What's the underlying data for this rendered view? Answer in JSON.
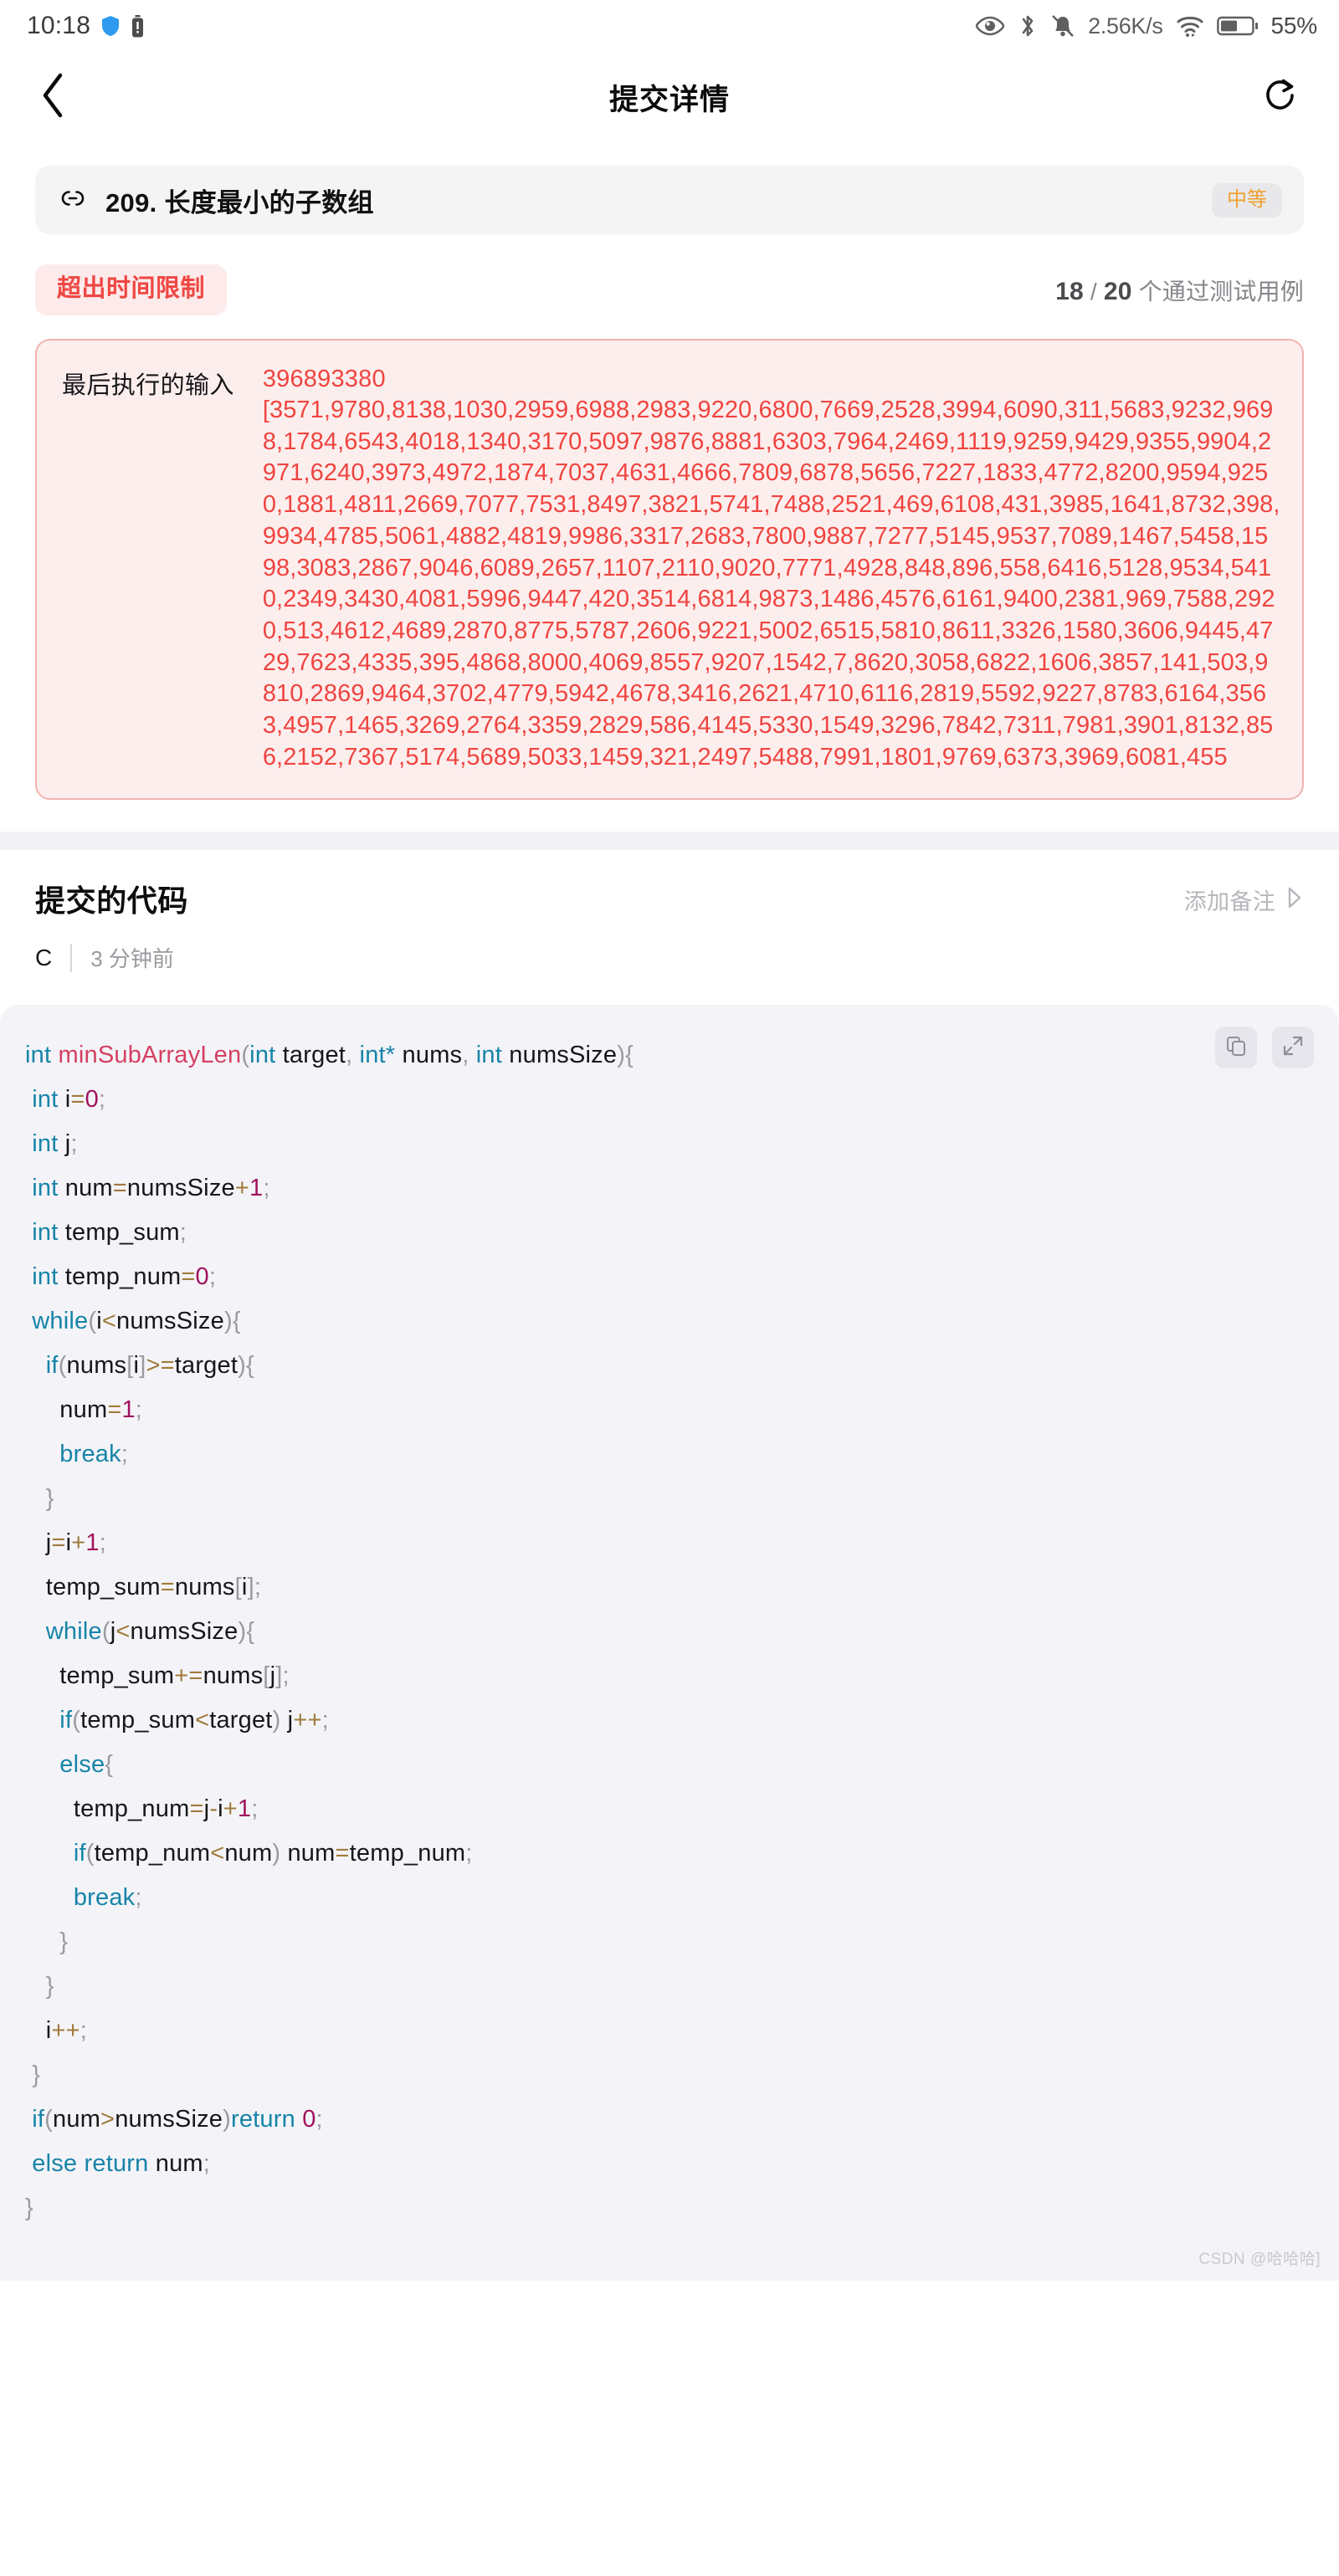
{
  "status_bar": {
    "time": "10:18",
    "network_speed": "2.56K/s",
    "battery_percent": "55%",
    "icons": [
      "shield-icon",
      "battery-small-icon",
      "eye-icon",
      "bluetooth-icon",
      "bell-off-icon",
      "wifi-icon",
      "battery-icon"
    ]
  },
  "header": {
    "title": "提交详情",
    "back_icon": "chevron-left-icon",
    "refresh_icon": "refresh-icon"
  },
  "problem": {
    "link_icon": "link-icon",
    "title": "209. 长度最小的子数组",
    "difficulty": "中等",
    "difficulty_color": "#f0a030"
  },
  "verdict": {
    "status": "超出时间限制",
    "status_color": "#ef4743",
    "status_bg": "#fdeaea",
    "passed": "18",
    "separator": "/",
    "total": "20",
    "cases_suffix": "个通过测试用例"
  },
  "last_input": {
    "label": "最后执行的输入",
    "target": "396893380",
    "array": "[3571,9780,8138,1030,2959,6988,2983,9220,6800,7669,2528,3994,6090,311,5683,9232,9698,1784,6543,4018,1340,3170,5097,9876,8881,6303,7964,2469,1119,9259,9429,9355,9904,2971,6240,3973,4972,1874,7037,4631,4666,7809,6878,5656,7227,1833,4772,8200,9594,9250,1881,4811,2669,7077,7531,8497,3821,5741,7488,2521,469,6108,431,3985,1641,8732,398,9934,4785,5061,4882,4819,9986,3317,2683,7800,9887,7277,5145,9537,7089,1467,5458,1598,3083,2867,9046,6089,2657,1107,2110,9020,7771,4928,848,896,558,6416,5128,9534,5410,2349,3430,4081,5996,9447,420,3514,6814,9873,1486,4576,6161,9400,2381,969,7588,2920,513,4612,4689,2870,8775,5787,2606,9221,5002,6515,5810,8611,3326,1580,3606,9445,4729,7623,4335,395,4868,8000,4069,8557,9207,1542,7,8620,3058,6822,1606,3857,141,503,9810,2869,9464,3702,4779,5942,4678,3416,2621,4710,6116,2819,5592,9227,8783,6164,3563,4957,1465,3269,2764,3359,2829,586,4145,5330,1549,3296,7842,7311,7981,3901,8132,856,2152,7367,5174,5689,5033,1459,321,2497,5488,7991,1801,9769,6373,3969,6081,455",
    "border_color": "#f1b3b1",
    "bg_color": "#fdeeee",
    "text_color": "#f0443f"
  },
  "code_section": {
    "title": "提交的代码",
    "add_note_label": "添加备注",
    "add_note_icon": "chevron-right-icon",
    "language": "C",
    "time_ago": "3 分钟前",
    "copy_icon": "copy-icon",
    "expand_icon": "expand-icon",
    "lines": [
      [
        {
          "t": "int ",
          "c": "tk-key"
        },
        {
          "t": "minSubArrayLen",
          "c": "tk-fn"
        },
        {
          "t": "(",
          "c": "tk-pun"
        },
        {
          "t": "int ",
          "c": "tk-key"
        },
        {
          "t": "target",
          "c": "tk-txt"
        },
        {
          "t": ",",
          "c": "tk-pun"
        },
        {
          "t": " int*",
          "c": "tk-key"
        },
        {
          "t": " nums",
          "c": "tk-txt"
        },
        {
          "t": ",",
          "c": "tk-pun"
        },
        {
          "t": " int ",
          "c": "tk-key"
        },
        {
          "t": "numsSize",
          "c": "tk-txt"
        },
        {
          "t": ")",
          "c": "tk-pun"
        },
        {
          "t": "{",
          "c": "tk-pun"
        }
      ],
      [
        {
          "t": " ",
          "c": "tk-txt"
        },
        {
          "t": "int ",
          "c": "tk-key"
        },
        {
          "t": "i",
          "c": "tk-txt"
        },
        {
          "t": "=",
          "c": "tk-op"
        },
        {
          "t": "0",
          "c": "tk-num"
        },
        {
          "t": ";",
          "c": "tk-pun"
        }
      ],
      [
        {
          "t": " ",
          "c": "tk-txt"
        },
        {
          "t": "int ",
          "c": "tk-key"
        },
        {
          "t": "j",
          "c": "tk-txt"
        },
        {
          "t": ";",
          "c": "tk-pun"
        }
      ],
      [
        {
          "t": " ",
          "c": "tk-txt"
        },
        {
          "t": "int ",
          "c": "tk-key"
        },
        {
          "t": "num",
          "c": "tk-txt"
        },
        {
          "t": "=",
          "c": "tk-op"
        },
        {
          "t": "numsSize",
          "c": "tk-txt"
        },
        {
          "t": "+",
          "c": "tk-op"
        },
        {
          "t": "1",
          "c": "tk-num"
        },
        {
          "t": ";",
          "c": "tk-pun"
        }
      ],
      [
        {
          "t": " ",
          "c": "tk-txt"
        },
        {
          "t": "int ",
          "c": "tk-key"
        },
        {
          "t": "temp_sum",
          "c": "tk-txt"
        },
        {
          "t": ";",
          "c": "tk-pun"
        }
      ],
      [
        {
          "t": " ",
          "c": "tk-txt"
        },
        {
          "t": "int ",
          "c": "tk-key"
        },
        {
          "t": "temp_num",
          "c": "tk-txt"
        },
        {
          "t": "=",
          "c": "tk-op"
        },
        {
          "t": "0",
          "c": "tk-num"
        },
        {
          "t": ";",
          "c": "tk-pun"
        }
      ],
      [
        {
          "t": " ",
          "c": "tk-txt"
        },
        {
          "t": "while",
          "c": "tk-key"
        },
        {
          "t": "(",
          "c": "tk-pun"
        },
        {
          "t": "i",
          "c": "tk-txt"
        },
        {
          "t": "<",
          "c": "tk-op"
        },
        {
          "t": "numsSize",
          "c": "tk-txt"
        },
        {
          "t": ")",
          "c": "tk-pun"
        },
        {
          "t": "{",
          "c": "tk-pun"
        }
      ],
      [
        {
          "t": "   ",
          "c": "tk-txt"
        },
        {
          "t": "if",
          "c": "tk-key"
        },
        {
          "t": "(",
          "c": "tk-pun"
        },
        {
          "t": "nums",
          "c": "tk-txt"
        },
        {
          "t": "[",
          "c": "tk-pun"
        },
        {
          "t": "i",
          "c": "tk-txt"
        },
        {
          "t": "]",
          "c": "tk-pun"
        },
        {
          "t": ">",
          "c": "tk-op"
        },
        {
          "t": "=",
          "c": "tk-op"
        },
        {
          "t": "target",
          "c": "tk-txt"
        },
        {
          "t": ")",
          "c": "tk-pun"
        },
        {
          "t": "{",
          "c": "tk-pun"
        }
      ],
      [
        {
          "t": "     ",
          "c": "tk-txt"
        },
        {
          "t": "num",
          "c": "tk-txt"
        },
        {
          "t": "=",
          "c": "tk-op"
        },
        {
          "t": "1",
          "c": "tk-num"
        },
        {
          "t": ";",
          "c": "tk-pun"
        }
      ],
      [
        {
          "t": "     ",
          "c": "tk-txt"
        },
        {
          "t": "break",
          "c": "tk-key"
        },
        {
          "t": ";",
          "c": "tk-pun"
        }
      ],
      [
        {
          "t": "   ",
          "c": "tk-txt"
        },
        {
          "t": "}",
          "c": "tk-pun"
        }
      ],
      [
        {
          "t": "   ",
          "c": "tk-txt"
        },
        {
          "t": "j",
          "c": "tk-txt"
        },
        {
          "t": "=",
          "c": "tk-op"
        },
        {
          "t": "i",
          "c": "tk-txt"
        },
        {
          "t": "+",
          "c": "tk-op"
        },
        {
          "t": "1",
          "c": "tk-num"
        },
        {
          "t": ";",
          "c": "tk-pun"
        }
      ],
      [
        {
          "t": "   ",
          "c": "tk-txt"
        },
        {
          "t": "temp_sum",
          "c": "tk-txt"
        },
        {
          "t": "=",
          "c": "tk-op"
        },
        {
          "t": "nums",
          "c": "tk-txt"
        },
        {
          "t": "[",
          "c": "tk-pun"
        },
        {
          "t": "i",
          "c": "tk-txt"
        },
        {
          "t": "]",
          "c": "tk-pun"
        },
        {
          "t": ";",
          "c": "tk-pun"
        }
      ],
      [
        {
          "t": "   ",
          "c": "tk-txt"
        },
        {
          "t": "while",
          "c": "tk-key"
        },
        {
          "t": "(",
          "c": "tk-pun"
        },
        {
          "t": "j",
          "c": "tk-txt"
        },
        {
          "t": "<",
          "c": "tk-op"
        },
        {
          "t": "numsSize",
          "c": "tk-txt"
        },
        {
          "t": ")",
          "c": "tk-pun"
        },
        {
          "t": "{",
          "c": "tk-pun"
        }
      ],
      [
        {
          "t": "     ",
          "c": "tk-txt"
        },
        {
          "t": "temp_sum",
          "c": "tk-txt"
        },
        {
          "t": "+=",
          "c": "tk-op"
        },
        {
          "t": "nums",
          "c": "tk-txt"
        },
        {
          "t": "[",
          "c": "tk-pun"
        },
        {
          "t": "j",
          "c": "tk-txt"
        },
        {
          "t": "]",
          "c": "tk-pun"
        },
        {
          "t": ";",
          "c": "tk-pun"
        }
      ],
      [
        {
          "t": "     ",
          "c": "tk-txt"
        },
        {
          "t": "if",
          "c": "tk-key"
        },
        {
          "t": "(",
          "c": "tk-pun"
        },
        {
          "t": "temp_sum",
          "c": "tk-txt"
        },
        {
          "t": "<",
          "c": "tk-op"
        },
        {
          "t": "target",
          "c": "tk-txt"
        },
        {
          "t": ")",
          "c": "tk-pun"
        },
        {
          "t": " j",
          "c": "tk-txt"
        },
        {
          "t": "++",
          "c": "tk-op"
        },
        {
          "t": ";",
          "c": "tk-pun"
        }
      ],
      [
        {
          "t": "     ",
          "c": "tk-txt"
        },
        {
          "t": "else",
          "c": "tk-key"
        },
        {
          "t": "{",
          "c": "tk-pun"
        }
      ],
      [
        {
          "t": "       ",
          "c": "tk-txt"
        },
        {
          "t": "temp_num",
          "c": "tk-txt"
        },
        {
          "t": "=",
          "c": "tk-op"
        },
        {
          "t": "j",
          "c": "tk-txt"
        },
        {
          "t": "-",
          "c": "tk-op"
        },
        {
          "t": "i",
          "c": "tk-txt"
        },
        {
          "t": "+",
          "c": "tk-op"
        },
        {
          "t": "1",
          "c": "tk-num"
        },
        {
          "t": ";",
          "c": "tk-pun"
        }
      ],
      [
        {
          "t": "       ",
          "c": "tk-txt"
        },
        {
          "t": "if",
          "c": "tk-key"
        },
        {
          "t": "(",
          "c": "tk-pun"
        },
        {
          "t": "temp_num",
          "c": "tk-txt"
        },
        {
          "t": "<",
          "c": "tk-op"
        },
        {
          "t": "num",
          "c": "tk-txt"
        },
        {
          "t": ")",
          "c": "tk-pun"
        },
        {
          "t": " num",
          "c": "tk-txt"
        },
        {
          "t": "=",
          "c": "tk-op"
        },
        {
          "t": "temp_num",
          "c": "tk-txt"
        },
        {
          "t": ";",
          "c": "tk-pun"
        }
      ],
      [
        {
          "t": "       ",
          "c": "tk-txt"
        },
        {
          "t": "break",
          "c": "tk-key"
        },
        {
          "t": ";",
          "c": "tk-pun"
        }
      ],
      [
        {
          "t": "     ",
          "c": "tk-txt"
        },
        {
          "t": "}",
          "c": "tk-pun"
        }
      ],
      [
        {
          "t": "   ",
          "c": "tk-txt"
        },
        {
          "t": "}",
          "c": "tk-pun"
        }
      ],
      [
        {
          "t": "   ",
          "c": "tk-txt"
        },
        {
          "t": "i",
          "c": "tk-txt"
        },
        {
          "t": "++",
          "c": "tk-op"
        },
        {
          "t": ";",
          "c": "tk-pun"
        }
      ],
      [
        {
          "t": " ",
          "c": "tk-txt"
        },
        {
          "t": "}",
          "c": "tk-pun"
        }
      ],
      [
        {
          "t": " ",
          "c": "tk-txt"
        },
        {
          "t": "if",
          "c": "tk-key"
        },
        {
          "t": "(",
          "c": "tk-pun"
        },
        {
          "t": "num",
          "c": "tk-txt"
        },
        {
          "t": ">",
          "c": "tk-op"
        },
        {
          "t": "numsSize",
          "c": "tk-txt"
        },
        {
          "t": ")",
          "c": "tk-pun"
        },
        {
          "t": "return ",
          "c": "tk-key"
        },
        {
          "t": "0",
          "c": "tk-num"
        },
        {
          "t": ";",
          "c": "tk-pun"
        }
      ],
      [
        {
          "t": " ",
          "c": "tk-txt"
        },
        {
          "t": "else return ",
          "c": "tk-key"
        },
        {
          "t": "num",
          "c": "tk-txt"
        },
        {
          "t": ";",
          "c": "tk-pun"
        }
      ],
      [
        {
          "t": "}",
          "c": "tk-pun"
        }
      ]
    ]
  },
  "watermark": "CSDN @哈哈哈]"
}
